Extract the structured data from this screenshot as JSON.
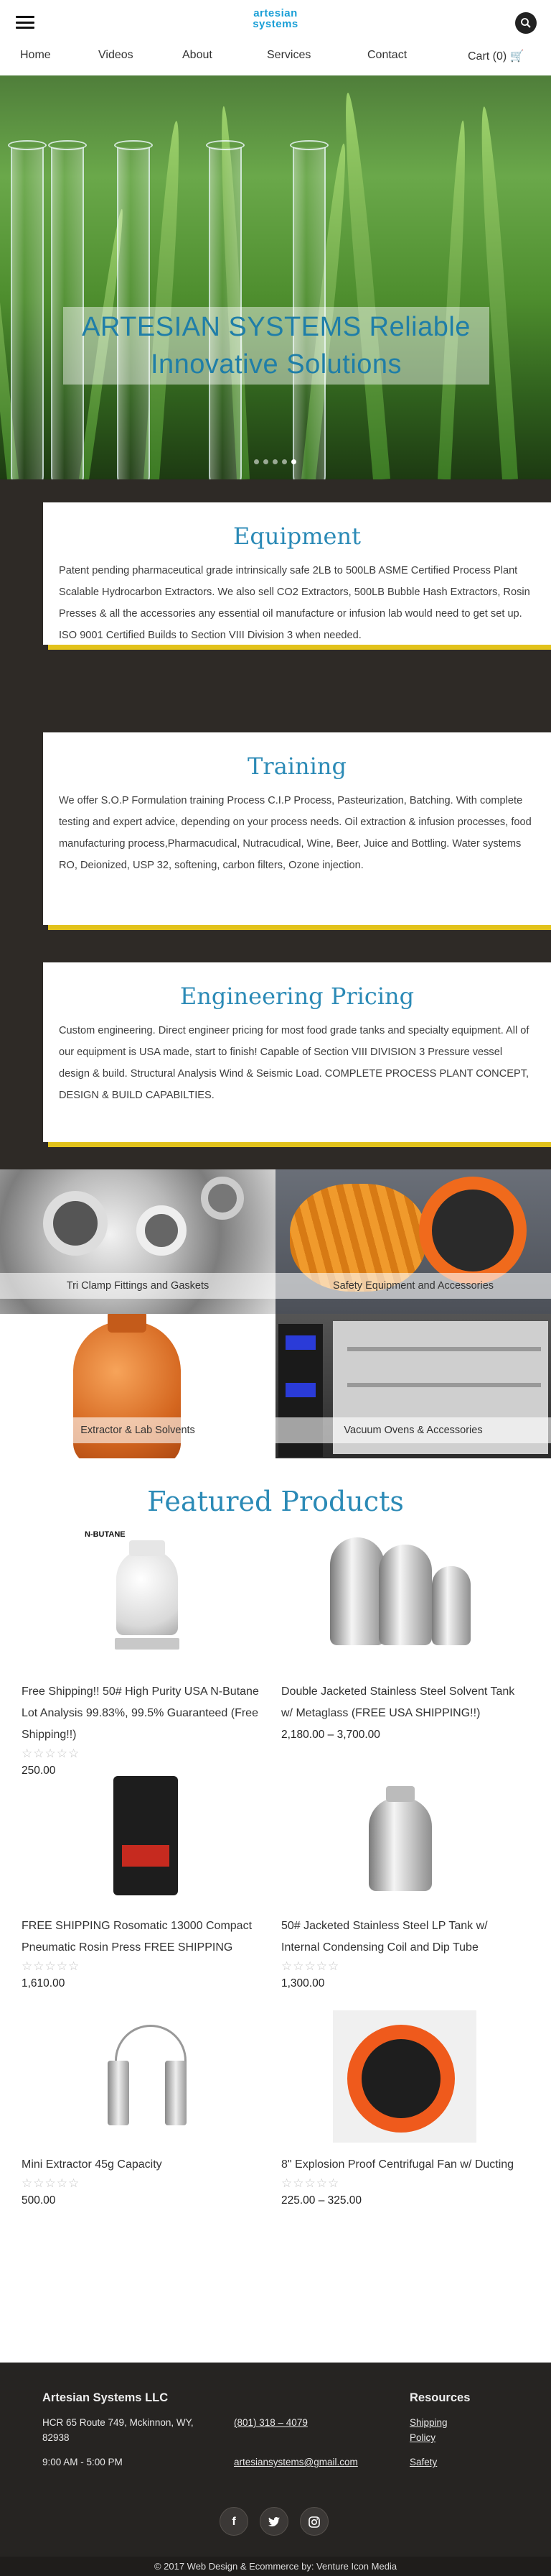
{
  "header": {
    "logo_line1": "artesian",
    "logo_line2": "systems"
  },
  "nav": {
    "items": [
      "Home",
      "Videos",
      "About",
      "Services",
      "Contact"
    ],
    "cart": "Cart (0)"
  },
  "hero": {
    "title": "ARTESIAN SYSTEMS Reliable Innovative Solutions",
    "slides": 5,
    "active_slide": 4
  },
  "cards": [
    {
      "title": "Equipment",
      "body": "Patent pending pharmaceutical grade intrinsically safe 2LB to 500LB ASME Certified Process Plant Scalable Hydrocarbon Extractors. We also sell CO2 Extractors, 500LB Bubble Hash Extractors, Rosin Presses & all the accessories any essential oil manufacture or infusion lab would need to get set up.",
      "body2": "ISO 9001 Certified Builds to Section VIII Division 3 when needed."
    },
    {
      "title": "Training",
      "body": "We offer S.O.P Formulation training Process C.I.P Process, Pasteurization, Batching. With complete testing and expert advice, depending on your process needs. Oil extraction & infusion processes, food manufacturing process,Pharmacudical, Nutracudical, Wine, Beer, Juice and Bottling. Water systems RO, Deionized, USP 32, softening, carbon filters, Ozone injection."
    },
    {
      "title": "Engineering Pricing",
      "body": "Custom engineering. Direct engineer pricing for most food grade tanks and specialty equipment.  All of our equipment is USA made, start to finish! Capable of Section VIII DIVISION 3 Pressure vessel design & build. Structural Analysis Wind & Seismic Load. COMPLETE PROCESS PLANT CONCEPT, DESIGN & BUILD CAPABILTIES."
    }
  ],
  "tiles": [
    "Tri Clamp Fittings and Gaskets",
    "Safety Equipment and Accessories",
    "Extractor & Lab Solvents",
    "Vacuum Ovens & Accessories"
  ],
  "featured": {
    "title": "Featured Products",
    "products": [
      {
        "name": "Free Shipping!! 50# High Purity USA N-Butane Lot Analysis 99.83%, 99.5% Guaranteed (Free Shipping!!)",
        "price": "250.00",
        "image_label": "N-BUTANE"
      },
      {
        "name": "Double Jacketed Stainless Steel Solvent Tank w/ Metaglass (FREE USA SHIPPING!!)",
        "price": "2,180.00 – 3,700.00"
      },
      {
        "name": "FREE SHIPPING Rosomatic 13000 Compact Pneumatic Rosin Press FREE SHIPPING",
        "price": "1,610.00"
      },
      {
        "name": "50# Jacketed Stainless Steel LP Tank w/ Internal Condensing Coil and Dip Tube",
        "price": "1,300.00"
      },
      {
        "name": "Mini Extractor 45g Capacity",
        "price": "500.00"
      },
      {
        "name": "8\" Explosion Proof Centrifugal Fan w/ Ducting",
        "price": "225.00 – 325.00"
      }
    ],
    "rating_stars": "☆☆☆☆☆"
  },
  "footer": {
    "company": "Artesian Systems LLC",
    "address": "HCR 65 Route 749, Mckinnon, WY, 82938",
    "hours": "9:00 AM - 5:00 PM",
    "phone": "(801) 318 – 4079",
    "email": "artesiansystems@gmail.com",
    "resources_title": "Resources",
    "links": [
      "Shipping",
      "Policy",
      "Safety"
    ],
    "social": [
      "f",
      "t",
      "ig"
    ],
    "copyright": "© 2017 Web Design & Ecommerce by: Venture Icon Media"
  },
  "colors": {
    "accent_blue": "#2b8ab6",
    "accent_yellow": "#e2c21b",
    "dark_band": "#2e2a26"
  }
}
